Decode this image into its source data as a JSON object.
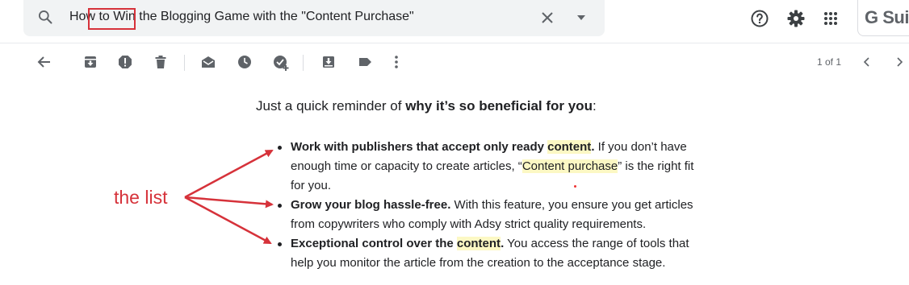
{
  "search": {
    "query_prefix": "How to",
    "query_rest": " Win the Blogging Game with the \"Content Purchase\""
  },
  "brand": {
    "gsuite_label": "G Sui"
  },
  "toolbar": {
    "pager": "1 of 1"
  },
  "email": {
    "intro_plain": "Just a quick reminder of ",
    "intro_bold": "why it’s so beneficial for you",
    "intro_end": ":",
    "bullets": [
      {
        "lines": [
          {
            "bold": "Work with publishers that accept only ready ",
            "hl_bold": "content",
            "bold2": ".",
            "plain": " If you don’t have"
          },
          {
            "plain": "enough time or capacity to create articles, “",
            "hl": "Content purchase",
            "plain2": "” is the right fit"
          },
          {
            "plain": "for you."
          }
        ]
      },
      {
        "lines": [
          {
            "bold": "Grow your blog hassle-free.",
            "plain": " With this feature, you ensure you get articles"
          },
          {
            "plain": "from copywriters who comply with Adsy strict quality requirements."
          }
        ]
      },
      {
        "lines": [
          {
            "bold": "Exceptional control over the ",
            "hl_bold": "content",
            "bold2": ".",
            "plain": " You access the range of tools that"
          },
          {
            "plain": "help you monitor the article from the creation to the acceptance stage."
          }
        ]
      }
    ]
  },
  "annotation": {
    "label": "the list",
    "color": "#d6323a"
  },
  "colors": {
    "highlight": "#fcf8c4",
    "icon": "#5f6368",
    "search_bg": "#f1f3f4"
  }
}
